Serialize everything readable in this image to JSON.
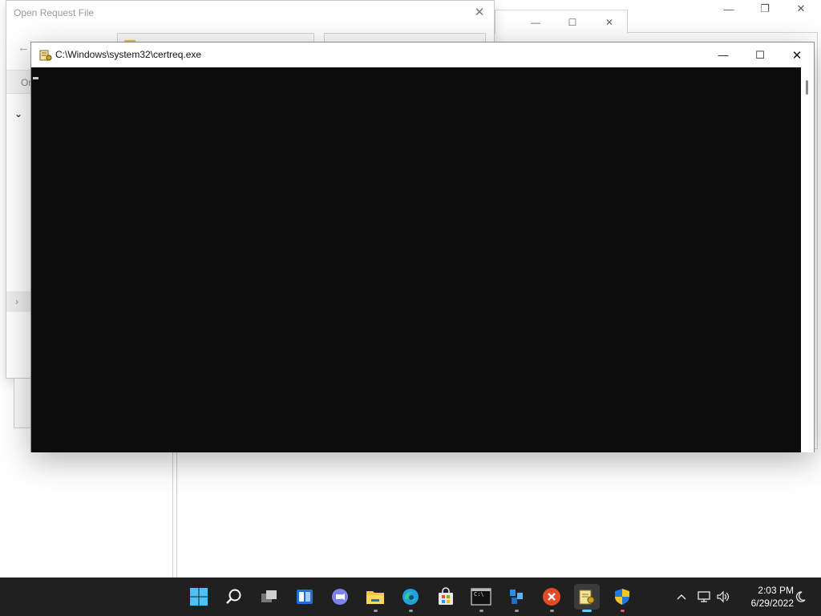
{
  "console": {
    "title": "C:\\Windows\\system32\\certreq.exe",
    "minimize_label": "—",
    "maximize_label": "☐",
    "close_label": "✕"
  },
  "dialog": {
    "title": "Open Request File",
    "toolbar_text": "Or",
    "close_label": "✕",
    "back_label": "←",
    "collapse_label": "⌄",
    "expand_label": "›"
  },
  "taskbar": {
    "items": [
      {
        "name": "start",
        "icon": "windows-logo-icon"
      },
      {
        "name": "search",
        "icon": "search-icon"
      },
      {
        "name": "task-view",
        "icon": "task-view-icon"
      },
      {
        "name": "widgets",
        "icon": "widgets-icon"
      },
      {
        "name": "chat",
        "icon": "teams-chat-icon"
      },
      {
        "name": "file-explorer",
        "icon": "folder-icon"
      },
      {
        "name": "edge",
        "icon": "edge-icon"
      },
      {
        "name": "store",
        "icon": "store-icon"
      },
      {
        "name": "terminal",
        "icon": "terminal-icon"
      },
      {
        "name": "network-app",
        "icon": "network-app-icon"
      },
      {
        "name": "red-app",
        "icon": "red-x-icon"
      },
      {
        "name": "certreq",
        "icon": "key-certificate-icon"
      },
      {
        "name": "security",
        "icon": "shield-icon"
      }
    ]
  },
  "tray": {
    "time": "2:03 PM",
    "date": "6/29/2022"
  }
}
